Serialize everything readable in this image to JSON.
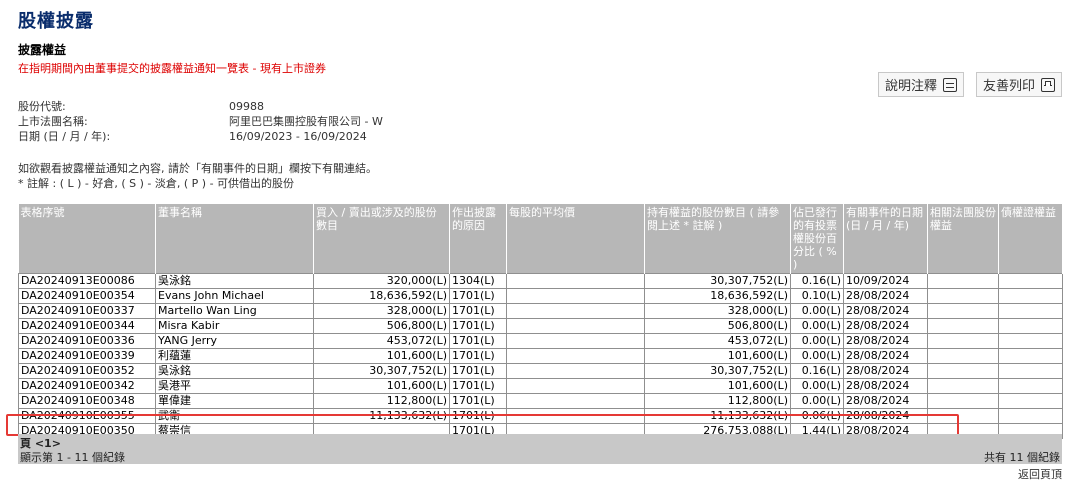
{
  "page": {
    "title": "股權披露",
    "section_title": "披露權益",
    "section_subtitle": "在指明期間內由董事提交的披露權益通知一覽表 - 現有上市證券",
    "actions": {
      "explain": "說明注釋",
      "print": "友善列印",
      "explain_icon": "note-icon",
      "print_icon": "print-icon"
    }
  },
  "info": {
    "stock_code_label": "股份代號:",
    "stock_code_value": "09988",
    "company_label": "上市法團名稱:",
    "company_value": "阿里巴巴集團控股有限公司 - W",
    "date_label": "日期 (日 / 月 / 年):",
    "date_value": "16/09/2023 - 16/09/2024"
  },
  "notes": {
    "line1": "如欲觀看披露權益通知之內容, 請於「有關事件的日期」欄按下有關連結。",
    "line2": "* 註解 : ( L ) - 好倉, ( S ) - 淡倉, ( P ) - 可供借出的股份"
  },
  "table": {
    "headers": [
      "表格序號",
      "董事名稱",
      "買入 / 賣出或涉及的股份數目",
      "作出披露的原因",
      "每股的平均價",
      "持有權益的股份數目 ( 請參閱上述 * 註解 )",
      "佔已發行的有投票權股份百分比 ( % )",
      "有關事件的日期 (日 / 月 / 年)",
      "相關法團股份權益",
      "債權證權益"
    ],
    "rows": [
      [
        "DA20240913E00086",
        "吳泳銘",
        "320,000(L)",
        "1304(L)",
        "",
        "30,307,752(L)",
        "0.16(L)",
        "10/09/2024",
        "",
        ""
      ],
      [
        "DA20240910E00354",
        "Evans John Michael",
        "18,636,592(L)",
        "1701(L)",
        "",
        "18,636,592(L)",
        "0.10(L)",
        "28/08/2024",
        "",
        ""
      ],
      [
        "DA20240910E00337",
        "Martello Wan Ling",
        "328,000(L)",
        "1701(L)",
        "",
        "328,000(L)",
        "0.00(L)",
        "28/08/2024",
        "",
        ""
      ],
      [
        "DA20240910E00344",
        "Misra Kabir",
        "506,800(L)",
        "1701(L)",
        "",
        "506,800(L)",
        "0.00(L)",
        "28/08/2024",
        "",
        ""
      ],
      [
        "DA20240910E00336",
        "YANG Jerry",
        "453,072(L)",
        "1701(L)",
        "",
        "453,072(L)",
        "0.00(L)",
        "28/08/2024",
        "",
        ""
      ],
      [
        "DA20240910E00339",
        "利蘊蓮",
        "101,600(L)",
        "1701(L)",
        "",
        "101,600(L)",
        "0.00(L)",
        "28/08/2024",
        "",
        ""
      ],
      [
        "DA20240910E00352",
        "吳泳銘",
        "30,307,752(L)",
        "1701(L)",
        "",
        "30,307,752(L)",
        "0.16(L)",
        "28/08/2024",
        "",
        ""
      ],
      [
        "DA20240910E00342",
        "吳港平",
        "101,600(L)",
        "1701(L)",
        "",
        "101,600(L)",
        "0.00(L)",
        "28/08/2024",
        "",
        ""
      ],
      [
        "DA20240910E00348",
        "單偉建",
        "112,800(L)",
        "1701(L)",
        "",
        "112,800(L)",
        "0.00(L)",
        "28/08/2024",
        "",
        ""
      ],
      [
        "DA20240910E00355",
        "武衛",
        "11,133,632(L)",
        "1701(L)",
        "",
        "11,133,632(L)",
        "0.06(L)",
        "28/08/2024",
        "",
        ""
      ],
      [
        "DA20240910E00350",
        "蔡崇信",
        "",
        "1701(L)",
        "",
        "276,753,088(L)",
        "1.44(L)",
        "28/08/2024",
        "",
        ""
      ]
    ],
    "highlight_index": 10,
    "highlight_color": "#e53935"
  },
  "footer": {
    "pager": "頁 <1>",
    "records_range": "顯示第 1 - 11 個紀錄",
    "records_total": "共有 11 個紀錄",
    "back_top": "返回頁頂"
  },
  "colors": {
    "title": "#0a2d6c",
    "header_bg": "#b7b7b7",
    "footer_bg": "#c8c8c8",
    "accent_red": "#d00"
  }
}
